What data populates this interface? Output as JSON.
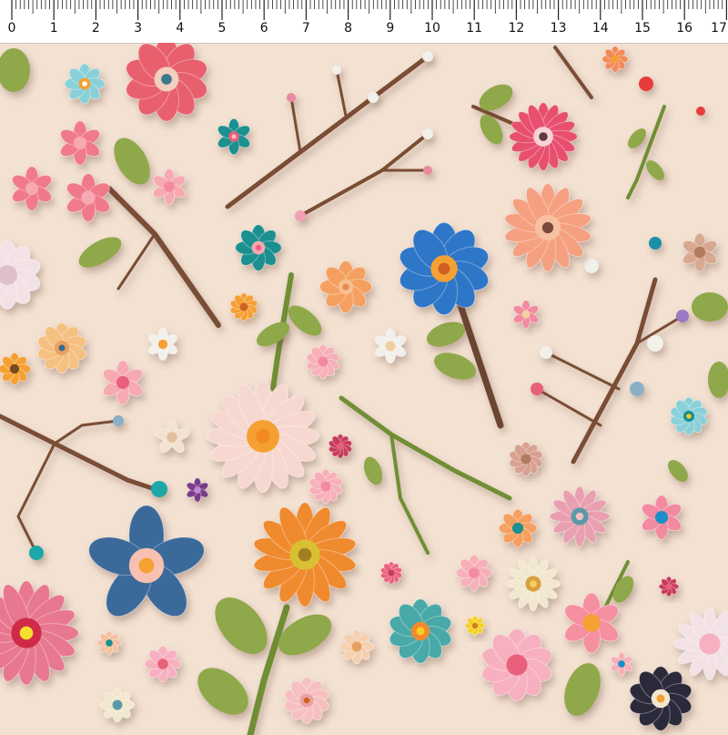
{
  "ruler": {
    "unit": "cm",
    "labels": [
      "0",
      "1",
      "2",
      "3",
      "4",
      "5",
      "6",
      "7",
      "8",
      "9",
      "10",
      "11",
      "12",
      "13",
      "14",
      "15",
      "16",
      "17"
    ]
  },
  "pattern": {
    "background_color": "#f3e1d2",
    "palette": {
      "pink": "#ef8aa0",
      "blue": "#2f76c7",
      "orange": "#f08a2e",
      "branch": "#8a5a3b",
      "leaf": "#8fa84a",
      "teal": "#1f8f8f"
    }
  }
}
